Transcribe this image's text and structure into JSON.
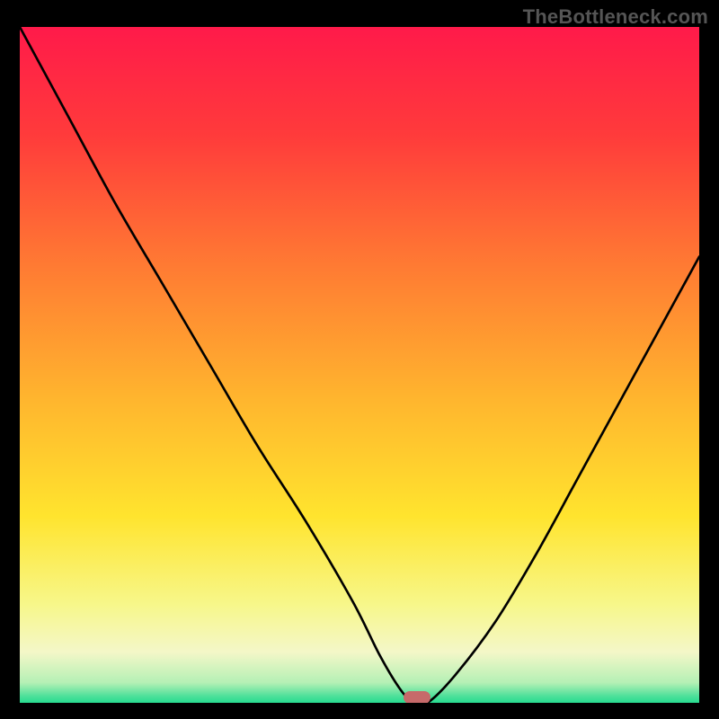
{
  "watermark": "TheBottleneck.com",
  "chart_data": {
    "type": "line",
    "title": "",
    "xlabel": "",
    "ylabel": "",
    "xlim": [
      0,
      100
    ],
    "ylim": [
      0,
      100
    ],
    "grid": false,
    "legend": false,
    "annotations": [],
    "series": [
      {
        "name": "bottleneck-curve",
        "x": [
          0,
          7,
          14,
          21,
          28,
          35,
          42,
          49,
          53,
          56,
          58,
          60,
          64,
          70,
          76,
          82,
          88,
          94,
          100
        ],
        "y": [
          100,
          87,
          74,
          62,
          50,
          38,
          27,
          15,
          7,
          2,
          0,
          0,
          4,
          12,
          22,
          33,
          44,
          55,
          66
        ]
      }
    ],
    "marker": {
      "name": "optimal-point",
      "x": 58.5,
      "y": 0.8,
      "color": "#c76a6a"
    },
    "gradient_stops": [
      {
        "offset": 0,
        "color": "#ff1a4a"
      },
      {
        "offset": 0.16,
        "color": "#ff3b3b"
      },
      {
        "offset": 0.35,
        "color": "#ff7a33"
      },
      {
        "offset": 0.55,
        "color": "#ffb62e"
      },
      {
        "offset": 0.72,
        "color": "#ffe42e"
      },
      {
        "offset": 0.85,
        "color": "#f7f78a"
      },
      {
        "offset": 0.92,
        "color": "#f4f7c8"
      },
      {
        "offset": 0.965,
        "color": "#b5f0b5"
      },
      {
        "offset": 0.985,
        "color": "#4de09a"
      },
      {
        "offset": 1.0,
        "color": "#12d98a"
      }
    ]
  }
}
